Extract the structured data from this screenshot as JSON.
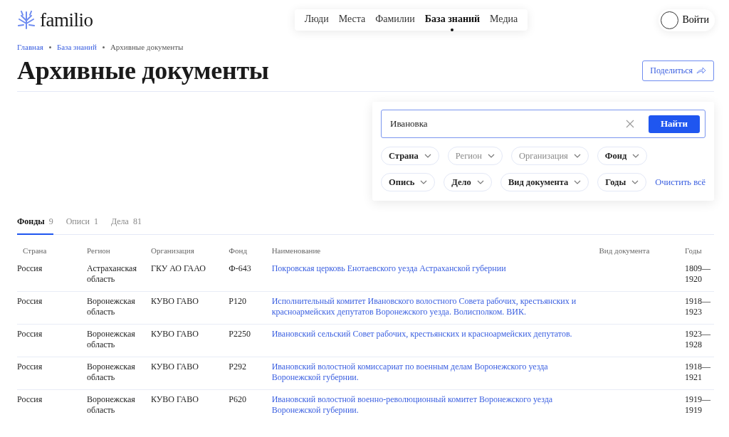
{
  "logo": {
    "text": "familio"
  },
  "nav": [
    {
      "label": "Люди",
      "selected": false
    },
    {
      "label": "Места",
      "selected": false
    },
    {
      "label": "Фамилии",
      "selected": false
    },
    {
      "label": "База знаний",
      "selected": true
    },
    {
      "label": "Медиа",
      "selected": false
    }
  ],
  "login": {
    "label": "Войти"
  },
  "breadcrumbs": [
    {
      "label": "Главная",
      "link": true
    },
    {
      "label": "База знаний",
      "link": true
    },
    {
      "label": "Архивные документы",
      "link": false
    }
  ],
  "title": "Архивные документы",
  "share_button": "Поделиться",
  "search": {
    "value": "Ивановка",
    "button": "Найти"
  },
  "filter_rows": [
    [
      {
        "label": "Страна",
        "disabled": false
      },
      {
        "label": "Регион",
        "disabled": true
      },
      {
        "label": "Организация",
        "disabled": true
      },
      {
        "label": "Фонд",
        "disabled": false
      }
    ],
    [
      {
        "label": "Опись",
        "disabled": false
      },
      {
        "label": "Дело",
        "disabled": false
      },
      {
        "label": "Вид документа",
        "disabled": false
      },
      {
        "label": "Годы",
        "disabled": false
      }
    ]
  ],
  "clear_all": "Очистить всё",
  "tabs": [
    {
      "label": "Фонды",
      "count": "9",
      "selected": true
    },
    {
      "label": "Описи",
      "count": "1",
      "selected": false
    },
    {
      "label": "Дела",
      "count": "81",
      "selected": false
    }
  ],
  "table": {
    "columns": [
      "Страна",
      "Регион",
      "Организация",
      "Фонд",
      "Наименование",
      "Вид документа",
      "Годы"
    ],
    "rows": [
      {
        "country": "Россия",
        "region": "Астраханская область",
        "organization": "ГКУ АО ГААО",
        "fund": "Ф-643",
        "name": "Покровская церковь Енотаевского уезда Астраханской губернии",
        "years": "1809—1920"
      },
      {
        "country": "Россия",
        "region": "Воронежская область",
        "organization": "КУВО ГАВО",
        "fund": "Р120",
        "name": "Исполнительный комитет Ивановского волостного Совета рабочих, крестьянских и красноармейских депутатов Воронежского уезда. Волисполком. ВИК.",
        "years": "1918—1923"
      },
      {
        "country": "Россия",
        "region": "Воронежская область",
        "organization": "КУВО ГАВО",
        "fund": "Р2250",
        "name": "Ивановский сельский Совет рабочих, крестьянских и красноармейских депутатов.",
        "years": "1923—1928"
      },
      {
        "country": "Россия",
        "region": "Воронежская область",
        "organization": "КУВО ГАВО",
        "fund": "Р292",
        "name": "Ивановский волостной комиссариат по военным делам Воронежского уезда Воронежской губернии.",
        "years": "1918—1921"
      },
      {
        "country": "Россия",
        "region": "Воронежская область",
        "organization": "КУВО ГАВО",
        "fund": "Р620",
        "name": "Ивановский волостной военно-революционный комитет Воронежского уезда Воронежской губернии.",
        "years": "1919—1919"
      }
    ]
  }
}
